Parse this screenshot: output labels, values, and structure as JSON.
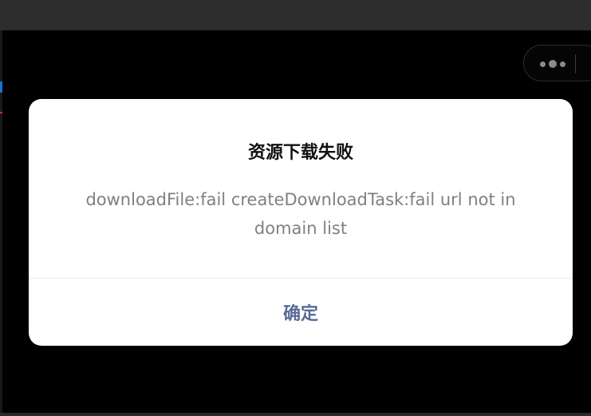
{
  "modal": {
    "title": "资源下载失败",
    "content": "downloadFile:fail createDownloadTask:fail url not in domain list",
    "confirm_label": "确定"
  },
  "capsule": {
    "more_icon": "more-dots-icon"
  },
  "colors": {
    "backdrop": "#000000",
    "titlebar": "#2d2d2d",
    "modal_bg": "#ffffff",
    "title_text": "#111111",
    "content_text": "#808080",
    "confirm_text": "#576b95"
  }
}
